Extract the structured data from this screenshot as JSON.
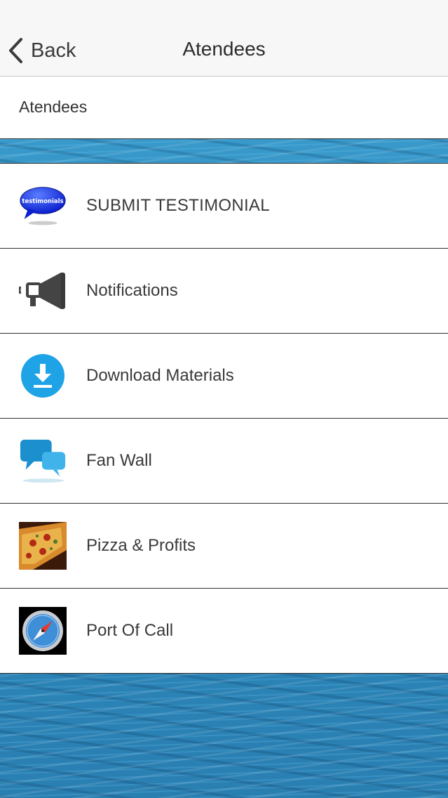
{
  "nav": {
    "back_label": "Back",
    "title": "Atendees"
  },
  "header": {
    "title": "Atendees"
  },
  "menu": {
    "items": [
      {
        "label": "SUBMIT TESTIMONIAL",
        "icon": "testimonials-bubble-icon",
        "icon_text": "testimonials"
      },
      {
        "label": "Notifications",
        "icon": "megaphone-icon"
      },
      {
        "label": "Download Materials",
        "icon": "download-icon"
      },
      {
        "label": "Fan Wall",
        "icon": "chat-bubbles-icon"
      },
      {
        "label": "Pizza & Profits",
        "icon": "pizza-icon"
      },
      {
        "label": "Port Of Call",
        "icon": "compass-icon"
      }
    ]
  },
  "colors": {
    "nav_bg": "#f7f7f8",
    "divider": "#2f2f2f",
    "water": "#2e8bbd",
    "download_blue": "#1ea3e6"
  }
}
